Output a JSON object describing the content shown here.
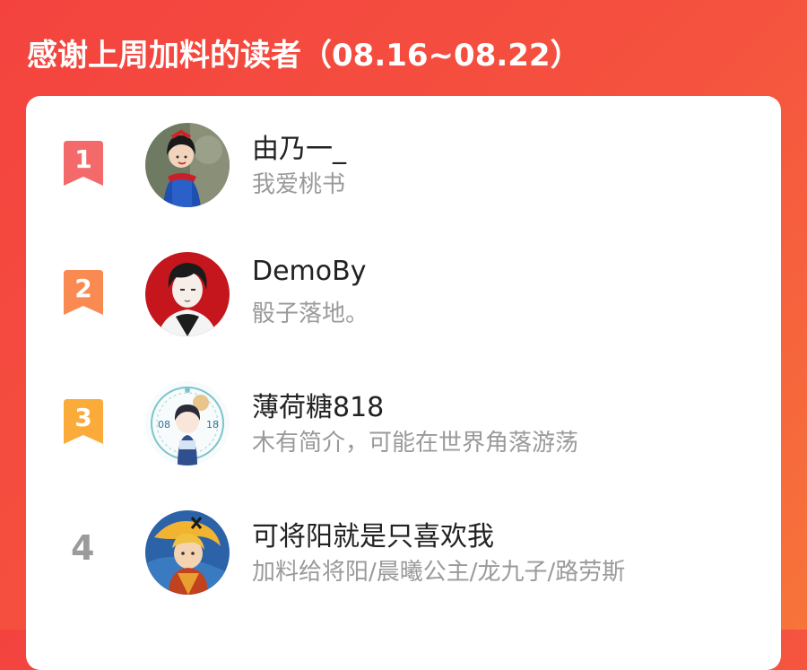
{
  "header": {
    "title": "感谢上周加料的读者（08.16~08.22）"
  },
  "colors": {
    "rank1": "#f46a6a",
    "rank2": "#f88a52",
    "rank3": "#fbab3a",
    "rank_plain": "#9b9b9b"
  },
  "readers": [
    {
      "rank": "1",
      "name": "由乃一_",
      "description": "我爱桃书",
      "avatar": "snow-white-avatar"
    },
    {
      "rank": "2",
      "name": "DemoBy",
      "description": "骰子落地。",
      "avatar": "dark-hair-boy-avatar"
    },
    {
      "rank": "3",
      "name": "薄荷糖818",
      "description": "木有简介，可能在世界角落游荡",
      "avatar": "birthday-badge-avatar"
    },
    {
      "rank": "4",
      "name": "可将阳就是只喜欢我",
      "description": "加料给将阳/晨曦公主/龙九子/路劳斯",
      "avatar": "anime-warrior-avatar"
    }
  ]
}
